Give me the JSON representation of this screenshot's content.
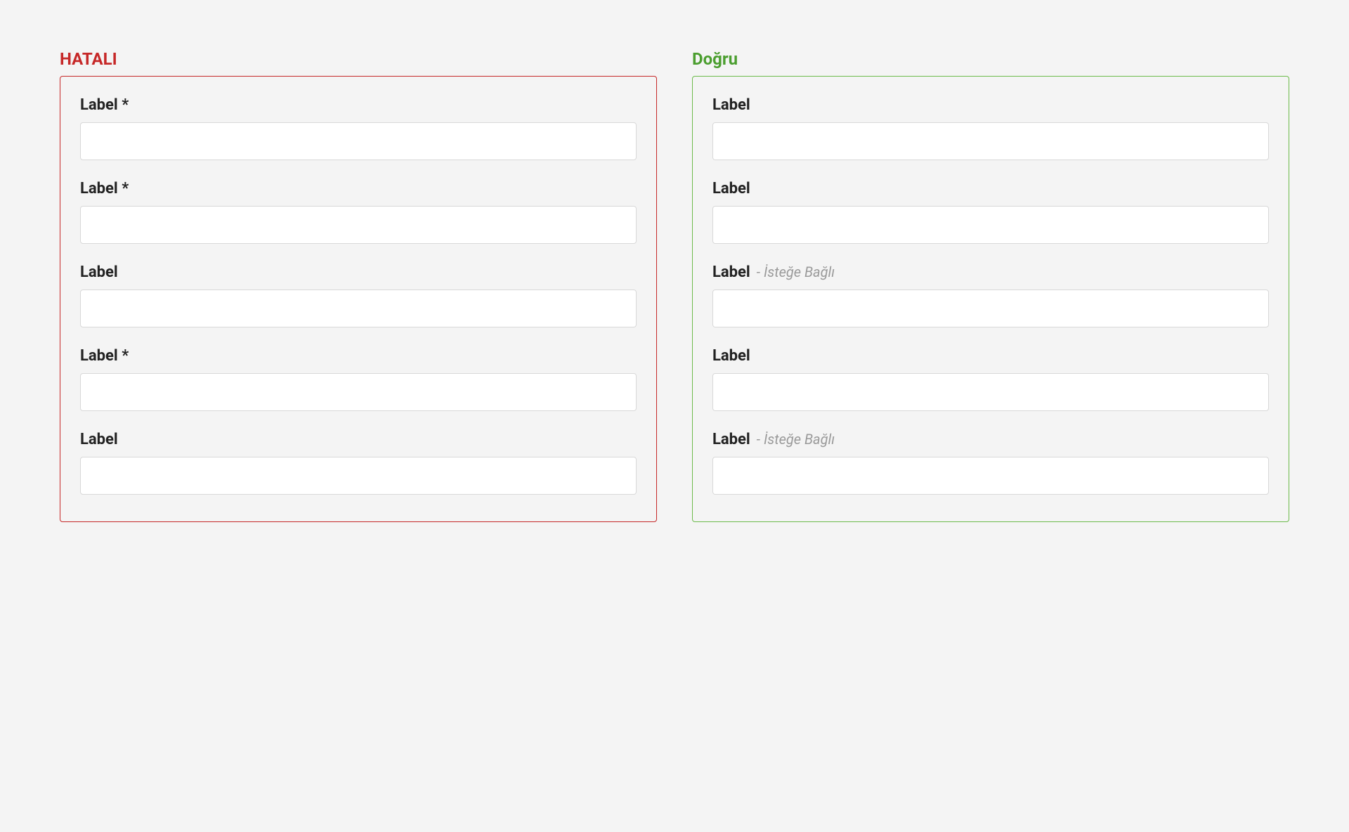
{
  "colors": {
    "incorrect": "#c62828",
    "correct": "#4b9e2f"
  },
  "incorrect": {
    "title": "HATALI",
    "fields": [
      {
        "label": "Label *"
      },
      {
        "label": "Label *"
      },
      {
        "label": "Label"
      },
      {
        "label": "Label *"
      },
      {
        "label": "Label"
      }
    ]
  },
  "correct": {
    "title": "Doğru",
    "fields": [
      {
        "label": "Label",
        "optional": ""
      },
      {
        "label": "Label",
        "optional": ""
      },
      {
        "label": "Label",
        "optional": " - İsteğe Bağlı"
      },
      {
        "label": "Label",
        "optional": ""
      },
      {
        "label": "Label",
        "optional": " - İsteğe Bağlı"
      }
    ]
  }
}
